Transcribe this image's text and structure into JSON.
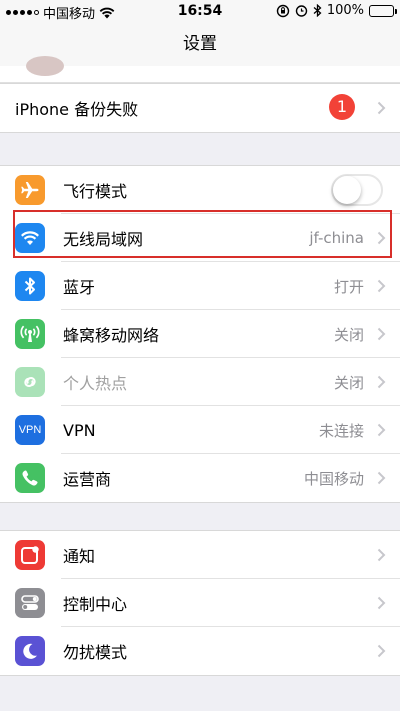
{
  "status_bar": {
    "carrier": "中国移动",
    "time": "16:54",
    "battery_percent": "100%"
  },
  "nav": {
    "title": "设置"
  },
  "backup_row": {
    "label": "iPhone 备份失败",
    "badge": "1"
  },
  "network_group": [
    {
      "id": "airplane",
      "icon": "airplane-icon",
      "icon_color": "#f89a2d",
      "label": "飞行模式",
      "value": "",
      "toggle": true,
      "toggle_on": false
    },
    {
      "id": "wifi",
      "icon": "wifi-icon",
      "icon_color": "#1e87f0",
      "label": "无线局域网",
      "value": "jf-china"
    },
    {
      "id": "bluetooth",
      "icon": "bluetooth-icon",
      "icon_color": "#1e87f0",
      "label": "蓝牙",
      "value": "打开"
    },
    {
      "id": "cellular",
      "icon": "antenna-icon",
      "icon_color": "#45c163",
      "label": "蜂窝移动网络",
      "value": "关闭"
    },
    {
      "id": "hotspot",
      "icon": "hotspot-icon",
      "icon_color": "#45c163",
      "label": "个人热点",
      "value": "关闭",
      "disabled": true
    },
    {
      "id": "vpn",
      "icon": "vpn-icon",
      "icon_color": "#1e6fe0",
      "label": "VPN",
      "value": "未连接",
      "icon_text": "VPN"
    },
    {
      "id": "carrier",
      "icon": "phone-icon",
      "icon_color": "#45c163",
      "label": "运营商",
      "value": "中国移动"
    }
  ],
  "system_group": [
    {
      "id": "notifications",
      "icon": "notification-icon",
      "icon_color": "#ee3a35",
      "label": "通知"
    },
    {
      "id": "control_center",
      "icon": "control-center-icon",
      "icon_color": "#8e8e93",
      "label": "控制中心"
    },
    {
      "id": "dnd",
      "icon": "moon-icon",
      "icon_color": "#5a52d4",
      "label": "勿扰模式"
    }
  ]
}
